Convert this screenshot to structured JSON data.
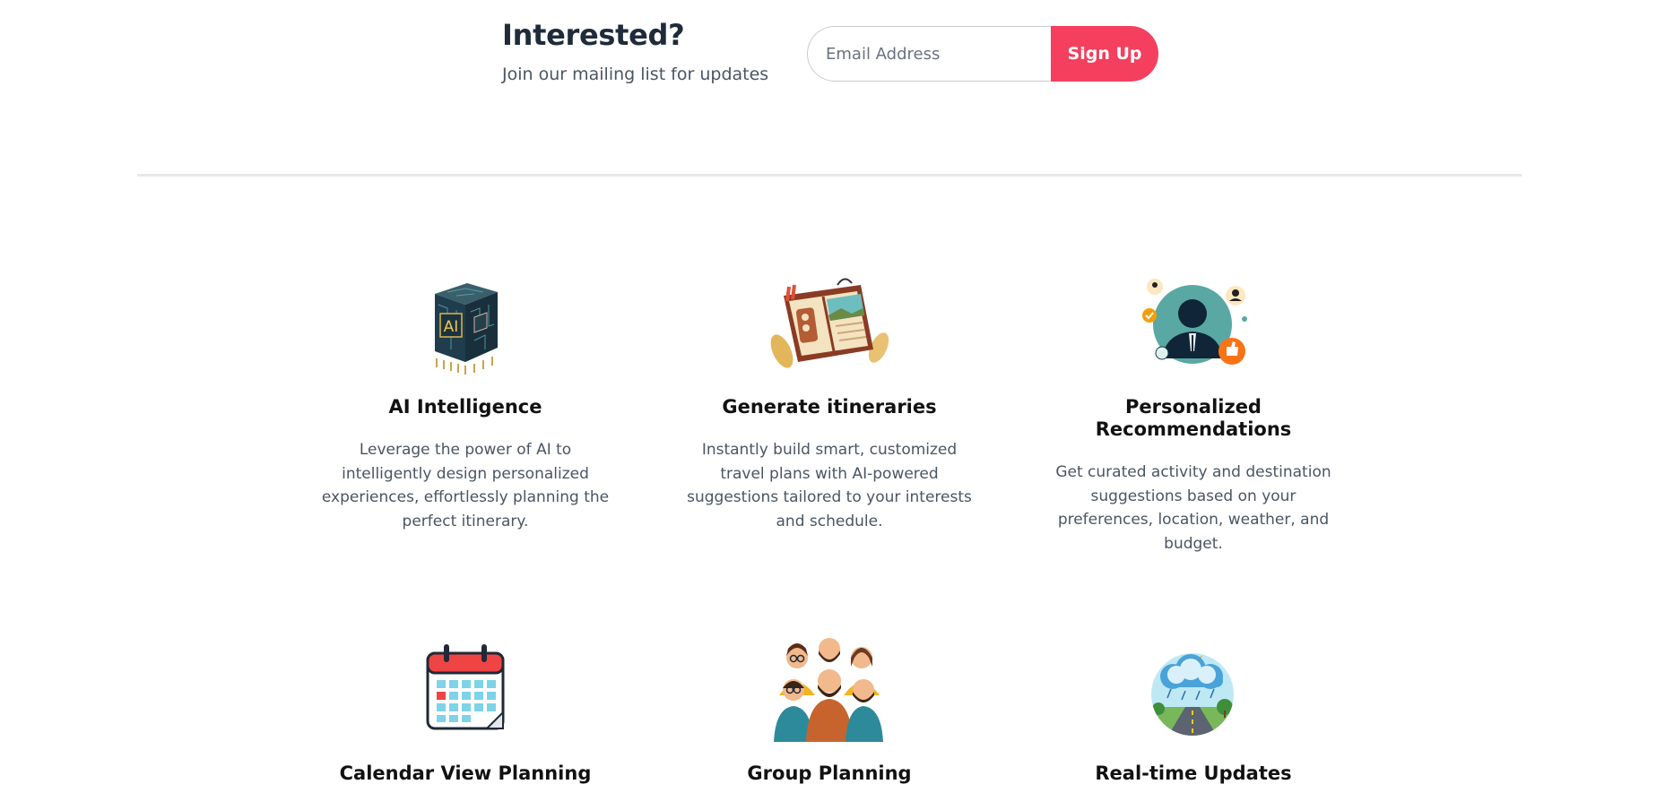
{
  "signup": {
    "heading": "Interested?",
    "subheading": "Join our mailing list for updates",
    "email_placeholder": "Email Address",
    "button_label": "Sign Up",
    "accent_color": "#f43f5e"
  },
  "features": [
    {
      "title": "AI Intelligence",
      "description": "Leverage the power of AI to intelligently design personalized experiences, effortlessly planning the perfect itinerary.",
      "icon": "ai-chip-icon"
    },
    {
      "title": "Generate itineraries",
      "description": "Instantly build smart, customized travel plans with AI-powered suggestions tailored to your interests and schedule.",
      "icon": "travel-book-icon"
    },
    {
      "title": "Personalized Recommendations",
      "description": "Get curated activity and destination suggestions based on your preferences, location, weather, and budget.",
      "icon": "profile-network-icon"
    },
    {
      "title": "Calendar View Planning",
      "description": "",
      "icon": "calendar-icon"
    },
    {
      "title": "Group Planning",
      "description": "",
      "icon": "group-people-icon"
    },
    {
      "title": "Real-time Updates",
      "description": "",
      "icon": "weather-road-icon"
    }
  ]
}
